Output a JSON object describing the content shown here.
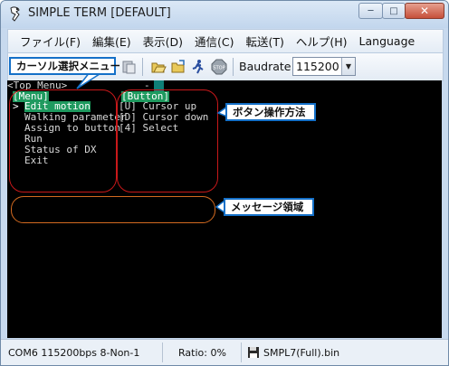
{
  "window": {
    "title": "SIMPLE TERM [DEFAULT]",
    "caption_min": "─",
    "caption_max": "□",
    "caption_close": "✕"
  },
  "menubar": {
    "items": [
      "ファイル(F)",
      "編集(E)",
      "表示(D)",
      "通信(C)",
      "転送(T)",
      "ヘルプ(H)",
      "Language"
    ]
  },
  "toolbar": {
    "baudrate_label": "Baudrate",
    "baudrate_value": "115200",
    "icons": [
      "cursor-select-menu-icon",
      "paste-icon",
      "folder-open-icon",
      "folder-send-icon",
      "run-icon",
      "stop-icon"
    ]
  },
  "terminal": {
    "top_line": "<Top Menu>",
    "top_dash": "-",
    "menu_header": "[Menu]",
    "menu_items": [
      "Edit motion",
      "Walking parameter",
      "Assign to button",
      "Run",
      "Status of DX",
      "Exit"
    ],
    "cursor_mark": ">",
    "button_header": "[Button]",
    "button_items": [
      "[U] Cursor up",
      "[D] Cursor down",
      "[4] Select"
    ]
  },
  "annotations": {
    "cursor_menu": "カーソル選択メニュー",
    "button_ops": "ボタン操作方法",
    "message_area": "メッセージ領域"
  },
  "statusbar": {
    "port": "COM6 115200bps 8-Non-1",
    "ratio": "Ratio: 0%",
    "file": "SMPL7(Full).bin"
  },
  "colors": {
    "terminal_bg": "#000000",
    "terminal_text": "#d8d8d8",
    "highlight": "#1f9a5f",
    "annotation_red": "#c8181a",
    "annotation_orange": "#d36a20",
    "callout_border": "#1470c8"
  }
}
